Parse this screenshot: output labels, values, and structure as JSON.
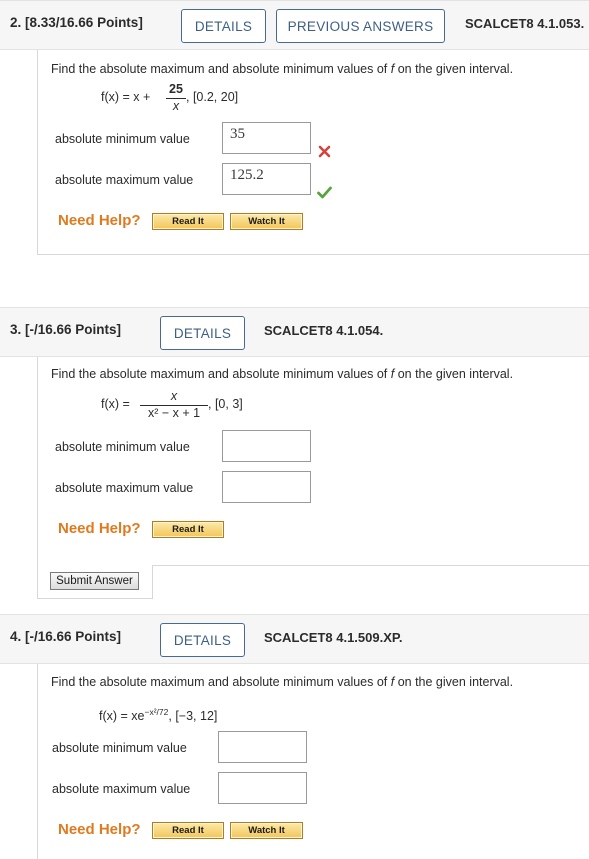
{
  "q2": {
    "number": "2.  [8.33/16.66 Points]",
    "details": "DETAILS",
    "previous_answers": "PREVIOUS ANSWERS",
    "code": "SCALCET8 4.1.053.",
    "prompt_pre": "Find the absolute maximum and absolute minimum values of ",
    "prompt_f": "f",
    "prompt_post": " on the given interval.",
    "func_lhs": "f(x) = x + ",
    "func_num": "25",
    "func_den": "x",
    "interval": ",  [0.2, 20]",
    "min_label": "absolute minimum value",
    "min_value": "35",
    "min_status": "incorrect",
    "max_label": "absolute maximum value",
    "max_value": "125.2",
    "max_status": "correct",
    "need_help": "Need Help?",
    "read_it": "Read It",
    "watch_it": "Watch It"
  },
  "q3": {
    "number": "3.  [-/16.66 Points]",
    "details": "DETAILS",
    "code": "SCALCET8 4.1.054.",
    "prompt_pre": "Find the absolute maximum and absolute minimum values of ",
    "prompt_f": "f",
    "prompt_post": " on the given interval.",
    "func_lhs": "f(x) = ",
    "func_num": "x",
    "func_den": "x² − x + 1",
    "interval": ",  [0, 3]",
    "min_label": "absolute minimum value",
    "min_value": "",
    "max_label": "absolute maximum value",
    "max_value": "",
    "need_help": "Need Help?",
    "read_it": "Read It",
    "submit": "Submit Answer"
  },
  "q4": {
    "number": "4.  [-/16.66 Points]",
    "details": "DETAILS",
    "code": "SCALCET8 4.1.509.XP.",
    "prompt_pre": "Find the absolute maximum and absolute minimum values of ",
    "prompt_f": "f",
    "prompt_post": " on the given interval.",
    "func_lhs": "f(x) = xe",
    "func_exp": "−x²/72",
    "interval": ",    [−3, 12]",
    "min_label": "absolute minimum value",
    "min_value": "",
    "max_label": "absolute maximum value",
    "max_value": "",
    "need_help": "Need Help?",
    "read_it": "Read It",
    "watch_it": "Watch It"
  },
  "colors": {
    "accent_blue": "#3d5f86",
    "help_orange": "#e07a1f",
    "correct_green": "#5aa33c",
    "incorrect_red": "#d0443c"
  }
}
